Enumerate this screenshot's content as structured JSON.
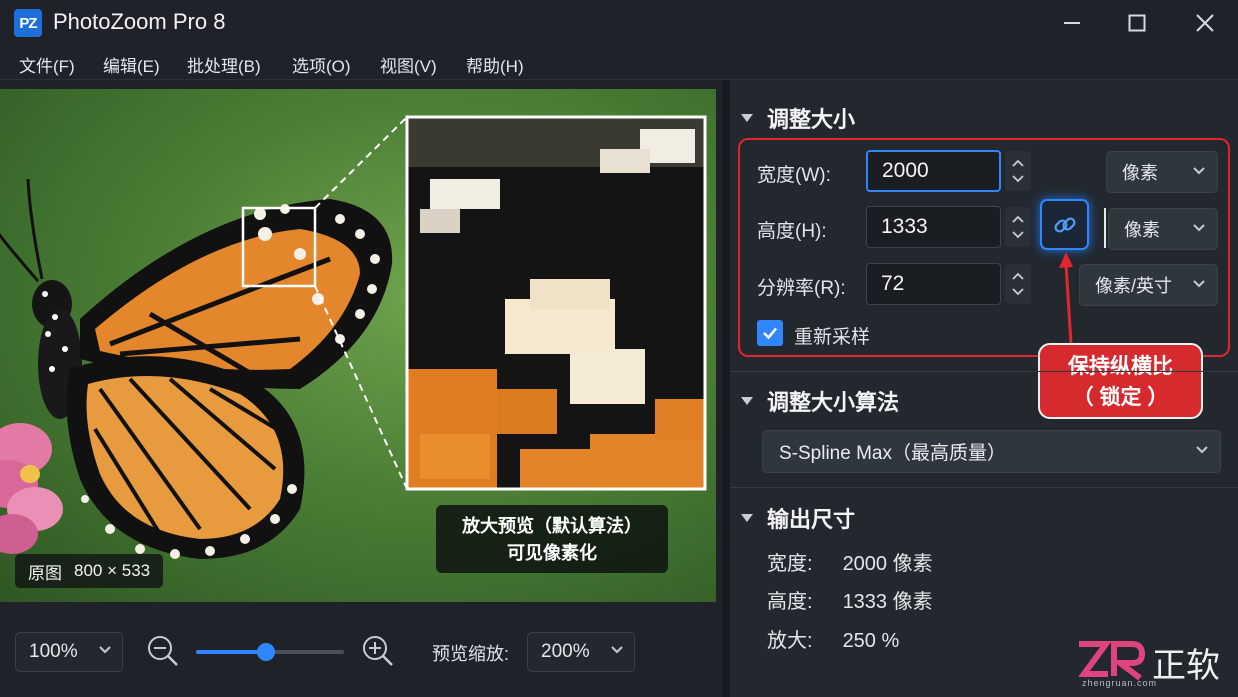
{
  "app": {
    "icon_text": "PZ",
    "title": "PhotoZoom Pro 8"
  },
  "menu": [
    "文件(F)",
    "编辑(E)",
    "批处理(B)",
    "选项(O)",
    "视图(V)",
    "帮助(H)"
  ],
  "preview": {
    "original_label": "原图",
    "original_size": "800 × 533",
    "caption_line1": "放大预览（默认算法）",
    "caption_line2": "可见像素化"
  },
  "bottom_bar": {
    "zoom_value": "100%",
    "slider_fraction": 0.47,
    "preview_zoom_label": "预览缩放:",
    "preview_zoom_value": "200%"
  },
  "resize": {
    "title": "调整大小",
    "width_label": "宽度(W):",
    "width_value": "2000",
    "width_unit": "像素",
    "height_label": "高度(H):",
    "height_value": "1333",
    "height_unit": "像素",
    "resolution_label": "分辨率(R):",
    "resolution_value": "72",
    "resolution_unit": "像素/英寸",
    "resample_label": "重新采样",
    "resample_checked": true,
    "callout_line1": "保持纵横比",
    "callout_line2": "（ 锁定 ）"
  },
  "algorithm": {
    "title": "调整大小算法",
    "selected": "S-Spline Max（最高质量）"
  },
  "output": {
    "title": "输出尺寸",
    "width_label": "宽度:",
    "width_value": "2000 像素",
    "height_label": "高度:",
    "height_value": "1333 像素",
    "scale_label": "放大:",
    "scale_value": "250 %"
  },
  "watermark": {
    "brand": "正软",
    "site": "zhengruan.com"
  },
  "colors": {
    "accent": "#2f86ff",
    "alert": "#e2262d",
    "background": "#1f2329",
    "panel": "#23282f"
  },
  "icons": [
    "minimize-icon",
    "maximize-icon",
    "close-icon",
    "zoom-out-icon",
    "zoom-in-icon",
    "chevron-down-icon",
    "link-icon",
    "check-icon",
    "expand-triangle-icon"
  ]
}
